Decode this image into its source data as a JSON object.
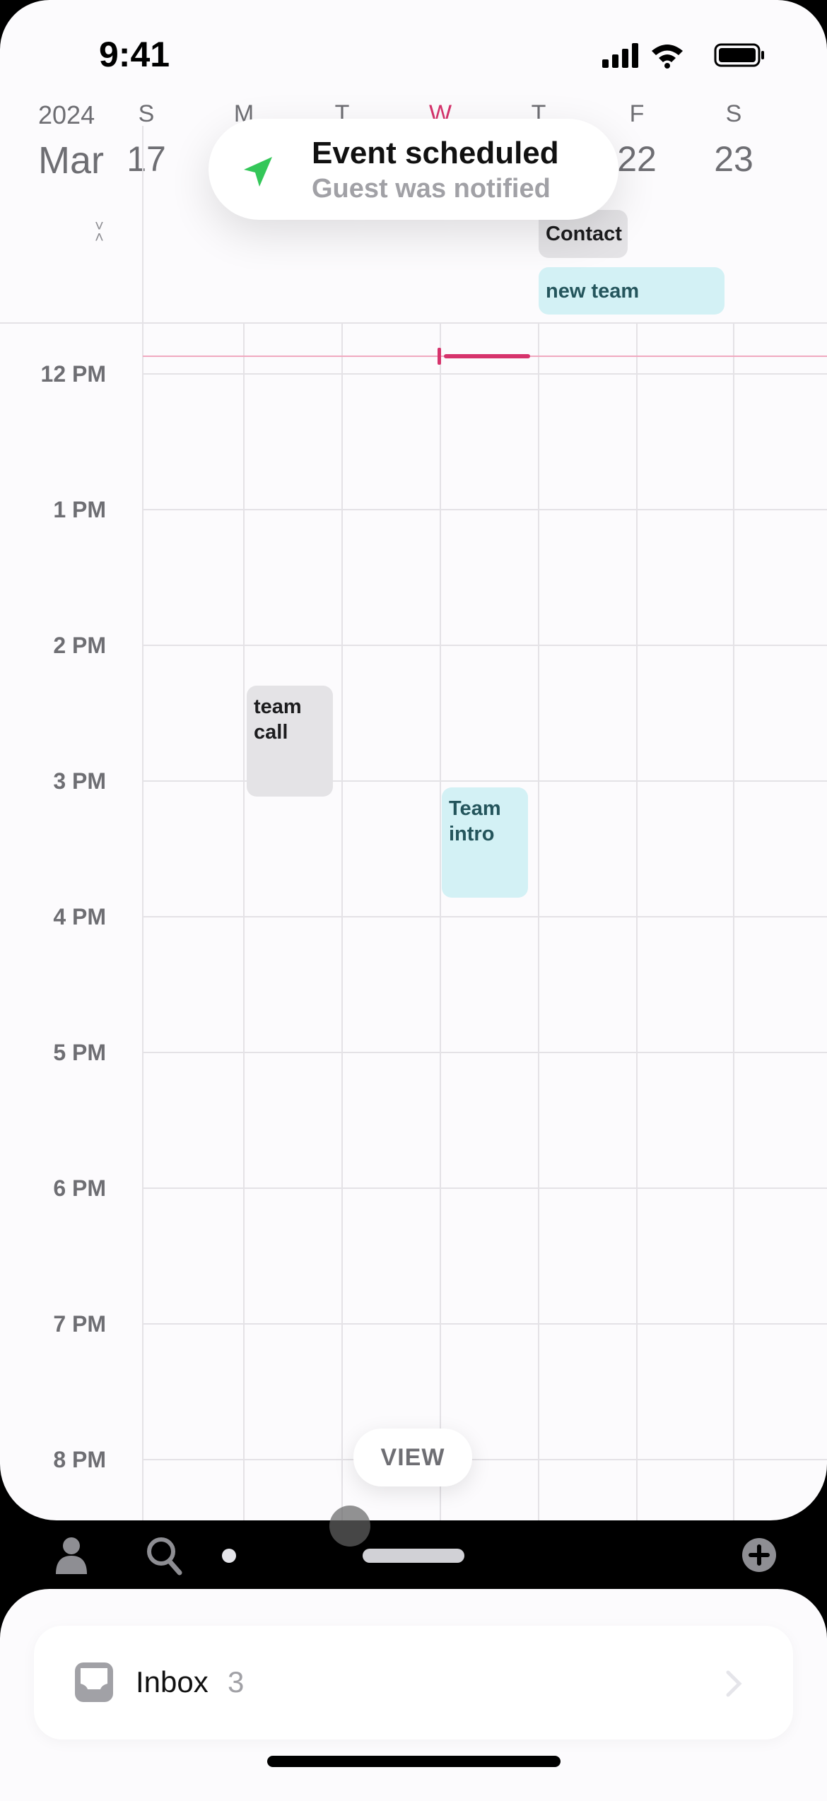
{
  "status_bar": {
    "time": "9:41"
  },
  "header": {
    "year": "2024",
    "month": "Mar",
    "days": [
      {
        "dow": "S",
        "date": "17"
      },
      {
        "dow": "M",
        "date": ""
      },
      {
        "dow": "T",
        "date": ""
      },
      {
        "dow": "W",
        "date": "",
        "today": true
      },
      {
        "dow": "T",
        "date": ""
      },
      {
        "dow": "F",
        "date": "22"
      },
      {
        "dow": "S",
        "date": "23"
      }
    ]
  },
  "toast": {
    "title": "Event scheduled",
    "subtitle": "Guest was notified",
    "icon": "paper-plane-icon",
    "icon_color": "#34c759"
  },
  "all_day_events": [
    {
      "title": "Contact",
      "color": "#e4e3e6"
    },
    {
      "title": "new team",
      "color": "#d3f1f5"
    }
  ],
  "hours": [
    "12 PM",
    "1 PM",
    "2 PM",
    "3 PM",
    "4 PM",
    "5 PM",
    "6 PM",
    "7 PM",
    "8 PM"
  ],
  "events": [
    {
      "title": "team call",
      "day": "M",
      "start": "2:30 PM",
      "end": "3:20 PM",
      "color": "#e4e3e6"
    },
    {
      "title": "Team intro",
      "day": "W",
      "start": "3:15 PM",
      "end": "4:05 PM",
      "color": "#d3f1f5"
    }
  ],
  "now_line_color": "#d6336c",
  "view_button": "VIEW",
  "toolbar": {
    "icons": [
      "person-icon",
      "search-icon",
      "dot-icon",
      "handle-icon",
      "plus-circle-icon"
    ]
  },
  "inbox": {
    "label": "Inbox",
    "count": "3"
  }
}
